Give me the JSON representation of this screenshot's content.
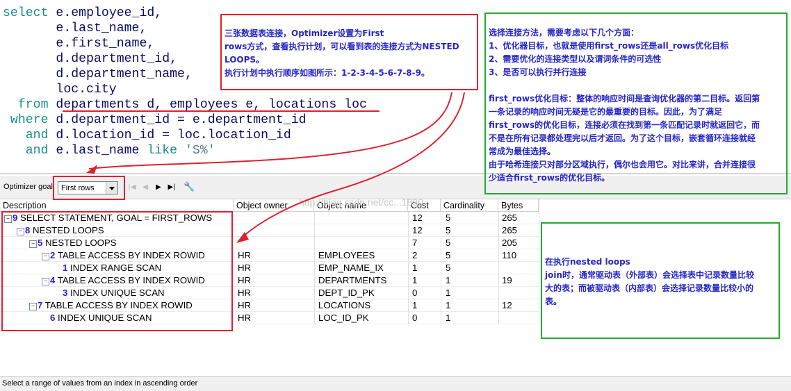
{
  "sql": {
    "lines": [
      {
        "kw": "select",
        "rest": " e.employee_id,"
      },
      {
        "kw": "",
        "rest": "       e.last_name,"
      },
      {
        "kw": "",
        "rest": "       e.first_name,"
      },
      {
        "kw": "",
        "rest": "       d.department_id,"
      },
      {
        "kw": "",
        "rest": "       d.department_name,"
      },
      {
        "kw": "",
        "rest": "       loc.city"
      },
      {
        "kw": "  from",
        "rest": " departments d, employees e, locations loc"
      },
      {
        "kw": " where",
        "rest": " d.department_id = e.department_id"
      },
      {
        "kw": "   and",
        "rest": " d.location_id = loc.location_id"
      },
      {
        "kw": "   and",
        "rest": " e.last_name ",
        "kw2": "like",
        "str": " 'S%'"
      }
    ]
  },
  "toolbar": {
    "optimizer_label": "Optimizer goal",
    "optimizer_value": "First rows"
  },
  "grid": {
    "columns": [
      "Description",
      "Object owner",
      "Object name",
      "Cost",
      "Cardinality",
      "Bytes"
    ],
    "rows": [
      {
        "depth": 0,
        "toggle": "−",
        "order": "9",
        "desc": "SELECT STATEMENT, GOAL = FIRST_ROWS",
        "owner": "",
        "name": "",
        "cost": "12",
        "card": "5",
        "bytes": "265"
      },
      {
        "depth": 1,
        "toggle": "−",
        "order": "8",
        "desc": "NESTED LOOPS",
        "owner": "",
        "name": "",
        "cost": "12",
        "card": "5",
        "bytes": "265"
      },
      {
        "depth": 2,
        "toggle": "−",
        "order": "5",
        "desc": "NESTED LOOPS",
        "owner": "",
        "name": "",
        "cost": "7",
        "card": "5",
        "bytes": "205"
      },
      {
        "depth": 3,
        "toggle": "−",
        "order": "2",
        "desc": "TABLE ACCESS BY INDEX ROWID",
        "owner": "HR",
        "name": "EMPLOYEES",
        "cost": "2",
        "card": "5",
        "bytes": "110"
      },
      {
        "depth": 4,
        "toggle": "",
        "order": "1",
        "desc": "INDEX RANGE SCAN",
        "owner": "HR",
        "name": "EMP_NAME_IX",
        "cost": "1",
        "card": "5",
        "bytes": ""
      },
      {
        "depth": 3,
        "toggle": "−",
        "order": "4",
        "desc": "TABLE ACCESS BY INDEX ROWID",
        "owner": "HR",
        "name": "DEPARTMENTS",
        "cost": "1",
        "card": "1",
        "bytes": "19"
      },
      {
        "depth": 4,
        "toggle": "",
        "order": "3",
        "desc": "INDEX UNIQUE SCAN",
        "owner": "HR",
        "name": "DEPT_ID_PK",
        "cost": "0",
        "card": "1",
        "bytes": ""
      },
      {
        "depth": 2,
        "toggle": "−",
        "order": "7",
        "desc": "TABLE ACCESS BY INDEX ROWID",
        "owner": "HR",
        "name": "LOCATIONS",
        "cost": "1",
        "card": "1",
        "bytes": "12"
      },
      {
        "depth": 3,
        "toggle": "",
        "order": "6",
        "desc": "INDEX UNIQUE SCAN",
        "owner": "HR",
        "name": "LOC_ID_PK",
        "cost": "0",
        "card": "1",
        "bytes": ""
      }
    ]
  },
  "status": {
    "text": "Select a range of values from an index in ascending order"
  },
  "watermark": "http://blog.csdn.net/cc...1890",
  "annotations": {
    "join_note": [
      "三张数据表连接，Optimizer设置为First",
      "rows方式，查看执行计划，可以看到表的连接方式为NESTED",
      "LOOPS。",
      "执行计划中执行顺序如图所示：1-2-3-4-5-6-7-8-9。"
    ],
    "method_note": [
      "选择连接方法，需要考虑以下几个方面：",
      "1、优化器目标，也就是使用first_rows还是all_rows优化目标",
      "2、需要优化的连接类型以及谓词条件的可选性",
      "3、是否可以执行并行连接",
      "",
      "first_rows优化目标：整体的响应时间是查询优化器的第二目标。返回第",
      "一条记录的响应时间无疑是它的最重要的目标。因此，为了满足",
      "first_rows的优化目标，连接必须在找到第一条匹配记录时就返回它，而",
      "不是在所有记录都处理完以后才返回。为了这个目标，嵌套循环连接就经",
      "常成为最佳选择。",
      "由于哈希连接只对部分区域执行，偶尔也会用它。对比来讲，合并连接很",
      "少适合first_rows的优化目标。"
    ],
    "nested_note": [
      "在执行nested loops",
      "join时，通常驱动表（外部表）会选择表中记录数量比较",
      "大的表；而被驱动表（内部表）会选择记录数量比较小的",
      "表。"
    ]
  },
  "colors": {
    "annotation_text": "#2626c8",
    "red_box": "#e02030",
    "green_box": "#22aa33",
    "sql_keyword": "#1a8c8c",
    "sql_text": "#0b0b66"
  }
}
